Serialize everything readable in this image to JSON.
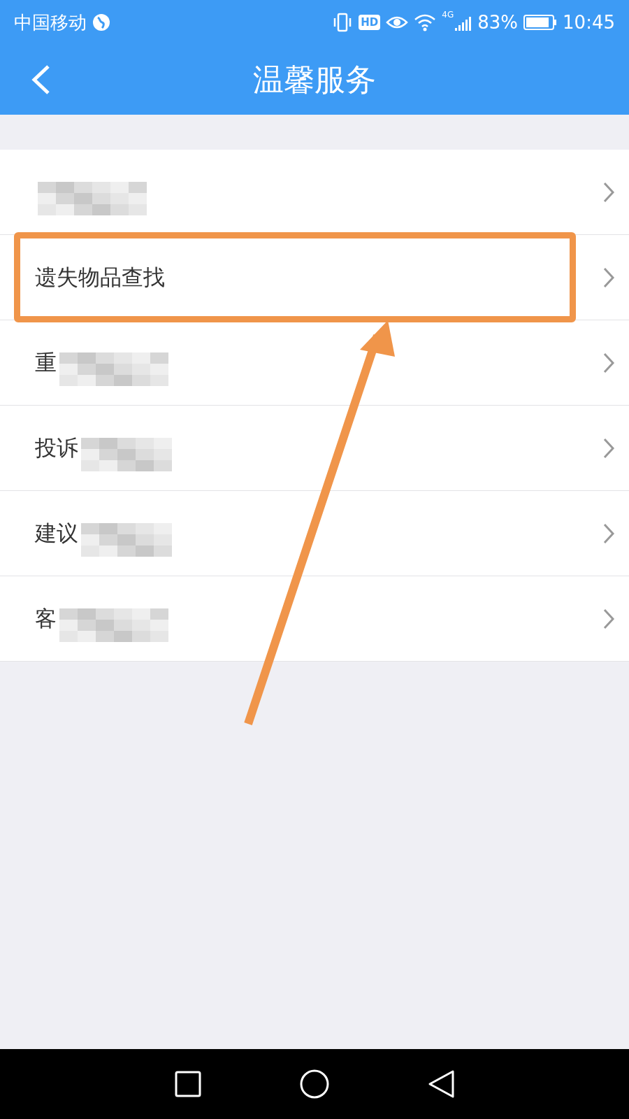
{
  "status_bar": {
    "carrier": "中国移动",
    "hd_badge": "HD",
    "network": "4G",
    "battery": "83%",
    "time": "10:45"
  },
  "header": {
    "title": "温馨服务"
  },
  "rows": [
    {
      "label": "",
      "pixelated": true,
      "highlighted": false
    },
    {
      "label": "遗失物品查找",
      "pixelated": false,
      "highlighted": true
    },
    {
      "label": "重",
      "pixelated": true,
      "highlighted": false
    },
    {
      "label": "投诉",
      "pixelated": true,
      "highlighted": false
    },
    {
      "label": "建议",
      "pixelated": true,
      "highlighted": false
    },
    {
      "label": "客",
      "pixelated": true,
      "highlighted": false
    }
  ]
}
